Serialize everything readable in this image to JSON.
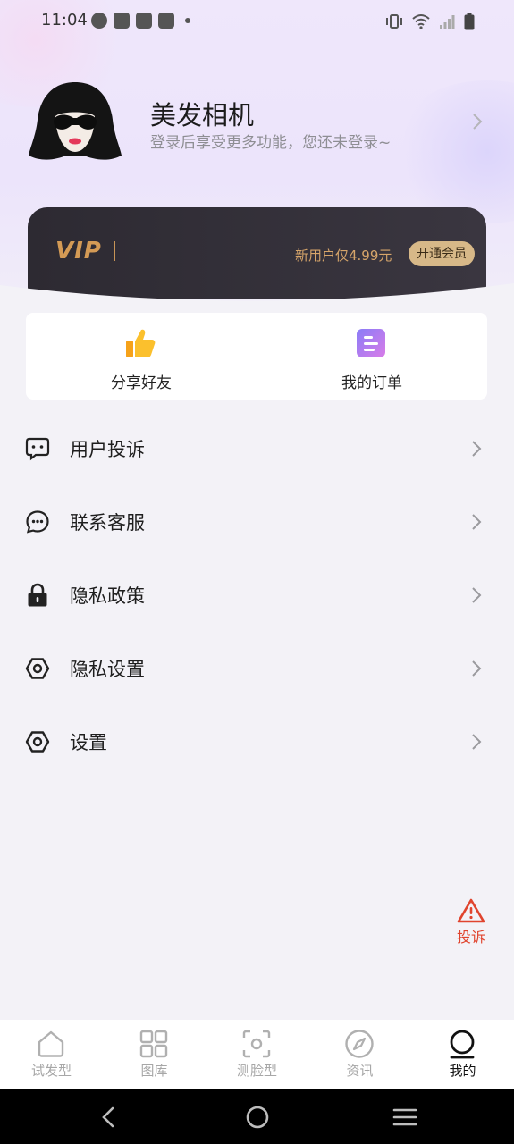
{
  "status_bar": {
    "time": "11:04"
  },
  "profile": {
    "name": "美发相机",
    "subtitle": "登录后享受更多功能，您还未登录~"
  },
  "vip": {
    "logo": "VIP",
    "offer": "新用户仅4.99元",
    "button": "开通会员"
  },
  "quick_actions": [
    {
      "label": "分享好友",
      "icon": "thumbs-up-icon"
    },
    {
      "label": "我的订单",
      "icon": "order-icon"
    }
  ],
  "menu": [
    {
      "label": "用户投诉",
      "icon": "chat-bubble-icon"
    },
    {
      "label": "联系客服",
      "icon": "customer-service-icon"
    },
    {
      "label": "隐私政策",
      "icon": "lock-icon"
    },
    {
      "label": "隐私设置",
      "icon": "hexagon-settings-icon"
    },
    {
      "label": "设置",
      "icon": "hexagon-settings-icon"
    }
  ],
  "complaint_fab": {
    "label": "投诉",
    "icon": "warning-icon"
  },
  "tabs": [
    {
      "label": "试发型",
      "icon": "home-icon",
      "active": false
    },
    {
      "label": "图库",
      "icon": "grid-icon",
      "active": false
    },
    {
      "label": "测脸型",
      "icon": "scan-face-icon",
      "active": false
    },
    {
      "label": "资讯",
      "icon": "compass-icon",
      "active": false
    },
    {
      "label": "我的",
      "icon": "profile-icon",
      "active": true
    }
  ],
  "colors": {
    "accent_gold": "#d39a55",
    "vip_button_bg": "#d7b888",
    "complaint_red": "#e0442e",
    "order_icon_gradient": [
      "#8a7cf7",
      "#d97ce8"
    ]
  }
}
